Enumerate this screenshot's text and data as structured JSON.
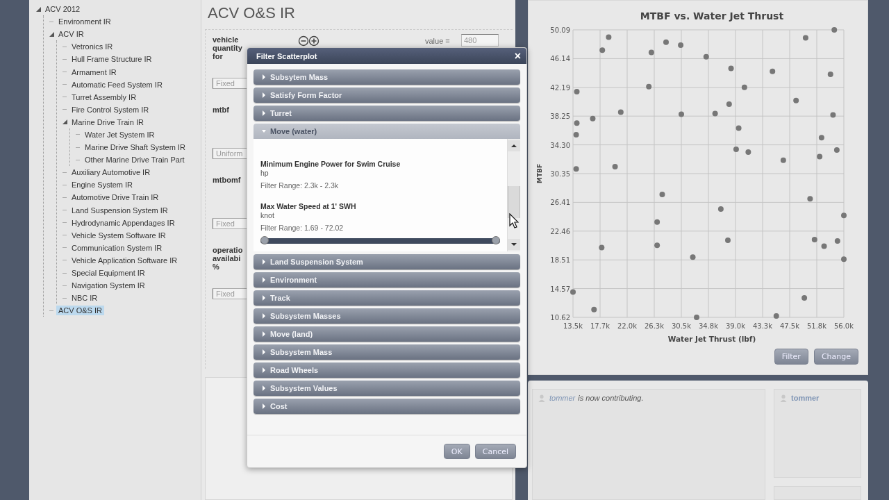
{
  "sidebar": {
    "tree": [
      {
        "label": "ACV 2012",
        "selected": false,
        "expanded": true,
        "children": [
          {
            "label": "Environment IR",
            "selected": false
          },
          {
            "label": "ACV IR",
            "selected": false,
            "expanded": true,
            "children": [
              {
                "label": "Vetronics IR",
                "selected": false
              },
              {
                "label": "Hull Frame Structure IR",
                "selected": false
              },
              {
                "label": "Armament IR",
                "selected": false
              },
              {
                "label": "Automatic Feed System IR",
                "selected": false
              },
              {
                "label": "Turret Assembly IR",
                "selected": false
              },
              {
                "label": "Fire Control System IR",
                "selected": false
              },
              {
                "label": "Marine Drive Train IR",
                "selected": false,
                "expanded": true,
                "children": [
                  {
                    "label": "Water Jet System IR",
                    "selected": false
                  },
                  {
                    "label": "Marine Drive Shaft System IR",
                    "selected": false
                  },
                  {
                    "label": "Other Marine Drive Train Part",
                    "selected": false
                  }
                ]
              },
              {
                "label": "Auxiliary Automotive IR",
                "selected": false
              },
              {
                "label": "Engine System IR",
                "selected": false
              },
              {
                "label": "Automotive Drive Train IR",
                "selected": false
              },
              {
                "label": "Land Suspension System IR",
                "selected": false
              },
              {
                "label": "Hydrodynamic Appendages IR",
                "selected": false
              },
              {
                "label": "Vehicle System Software IR",
                "selected": false
              },
              {
                "label": "Communication System IR",
                "selected": false
              },
              {
                "label": "Vehicle Application Software IR",
                "selected": false
              },
              {
                "label": "Special Equipment IR",
                "selected": false
              },
              {
                "label": "Navigation System IR",
                "selected": false
              },
              {
                "label": "NBC IR",
                "selected": false
              }
            ]
          },
          {
            "label": "ACV O&S IR",
            "selected": true
          }
        ]
      }
    ]
  },
  "main": {
    "title": "ACV O&S IR",
    "value_label": "value =",
    "value": "480",
    "parameters": [
      {
        "label": "vehicle quantity for",
        "distribution": "Fixed"
      },
      {
        "label": "mtbf",
        "distribution": "Uniform"
      },
      {
        "label": "mtbomf",
        "distribution": "Fixed"
      },
      {
        "label": "operatio availabi %",
        "distribution": "Fixed"
      }
    ]
  },
  "dialog": {
    "title": "Filter Scatterplot",
    "close": "×",
    "sections": [
      {
        "label": "Subsytem Mass",
        "expanded": false
      },
      {
        "label": "Satisfy Form Factor",
        "expanded": false
      },
      {
        "label": "Turret",
        "expanded": false
      },
      {
        "label": "Move (water)",
        "expanded": true,
        "fields": [
          {
            "name": "Minimum Engine Power for Swim Cruise",
            "unit": "hp",
            "range": "Filter Range: 2.3k - 2.3k"
          },
          {
            "name": "Max Water Speed at 1' SWH",
            "unit": "knot",
            "range": "Filter Range: 1.69 - 72.02",
            "level": 1
          }
        ]
      },
      {
        "label": "Land Suspension System",
        "expanded": false
      },
      {
        "label": "Environment",
        "expanded": false
      },
      {
        "label": "Track",
        "expanded": false
      },
      {
        "label": "Subsystem Masses",
        "expanded": false
      },
      {
        "label": "Move (land)",
        "expanded": false
      },
      {
        "label": "Subsystem Mass",
        "expanded": false
      },
      {
        "label": "Road Wheels",
        "expanded": false
      },
      {
        "label": "Subsystem Values",
        "expanded": false
      },
      {
        "label": "Cost",
        "expanded": false
      }
    ],
    "buttons": [
      "OK",
      "Cancel"
    ]
  },
  "chart_panel": {
    "chart_data": {
      "type": "scatter",
      "title": "MTBF vs. Water Jet Thrust",
      "xlabel": "Water Jet Thrust (lbf)",
      "ylabel": "MTBF",
      "grid": true,
      "xlim": [
        13.5,
        56.0
      ],
      "ylim": [
        10.62,
        50.09
      ],
      "xticks": [
        {
          "value": 13.5,
          "label": "13.5k"
        },
        {
          "value": 17.75,
          "label": "17.7k"
        },
        {
          "value": 22.0,
          "label": "22.0k"
        },
        {
          "value": 26.25,
          "label": "26.3k"
        },
        {
          "value": 30.5,
          "label": "30.5k"
        },
        {
          "value": 34.75,
          "label": "34.8k"
        },
        {
          "value": 39.0,
          "label": "39.0k"
        },
        {
          "value": 43.25,
          "label": "43.3k"
        },
        {
          "value": 47.5,
          "label": "47.5k"
        },
        {
          "value": 51.75,
          "label": "51.8k"
        },
        {
          "value": 56.0,
          "label": "56.0k"
        }
      ],
      "yticks": [
        {
          "value": 10.62,
          "label": "10.62"
        },
        {
          "value": 14.57,
          "label": "14.57"
        },
        {
          "value": 18.51,
          "label": "18.51"
        },
        {
          "value": 22.46,
          "label": "22.46"
        },
        {
          "value": 26.41,
          "label": "26.41"
        },
        {
          "value": 30.35,
          "label": "30.35"
        },
        {
          "value": 34.3,
          "label": "34.30"
        },
        {
          "value": 38.25,
          "label": "38.25"
        },
        {
          "value": 42.19,
          "label": "42.19"
        },
        {
          "value": 46.14,
          "label": "46.14"
        },
        {
          "value": 50.09,
          "label": "50.09"
        }
      ],
      "x": [
        19.1,
        18.1,
        25.8,
        28.1,
        30.4,
        34.4,
        38.3,
        44.8,
        50.0,
        54.5,
        53.9,
        25.4,
        40.4,
        14.1,
        38.0,
        48.5,
        21.0,
        16.6,
        14.1,
        30.5,
        35.8,
        54.3,
        14.0,
        39.5,
        52.5,
        39.1,
        41.0,
        54.9,
        52.2,
        46.5,
        14.0,
        20.1,
        27.5,
        50.7,
        36.7,
        56.0,
        26.7,
        26.7,
        18.0,
        37.8,
        51.4,
        52.9,
        55.0,
        32.3,
        56.0,
        13.5,
        49.8,
        16.8,
        32.9,
        45.4
      ],
      "series": [
        {
          "color": "#777777",
          "values": [
            49.1,
            47.3,
            47.0,
            48.4,
            48.0,
            46.4,
            44.8,
            44.4,
            49.0,
            50.09,
            44.0,
            42.3,
            42.2,
            41.6,
            39.9,
            40.4,
            38.8,
            37.9,
            37.3,
            38.5,
            38.6,
            38.4,
            35.7,
            36.6,
            35.3,
            33.7,
            33.3,
            33.6,
            32.7,
            32.2,
            31.0,
            31.3,
            27.5,
            26.9,
            25.5,
            24.6,
            23.7,
            20.5,
            20.2,
            21.2,
            21.3,
            20.4,
            21.1,
            18.9,
            18.6,
            14.1,
            13.3,
            11.7,
            10.62,
            10.8
          ]
        }
      ]
    },
    "buttons": [
      "Filter",
      "Change"
    ]
  },
  "activity": {
    "messages": [
      {
        "user": "tommer",
        "text": "is now contributing."
      }
    ]
  },
  "participants": [
    {
      "name": "tommer"
    }
  ]
}
